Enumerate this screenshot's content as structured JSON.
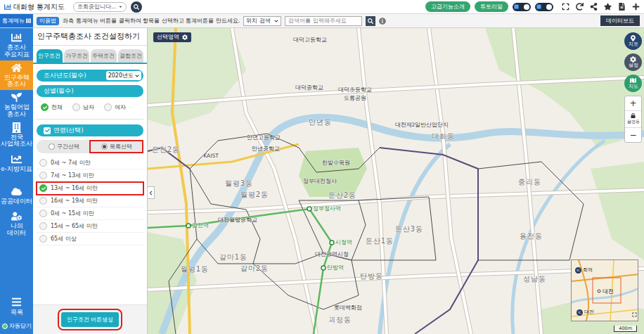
{
  "header": {
    "logo": "대화형 통계지도",
    "status_select": "조회중입니다...",
    "buttons": [
      "고급기능소개",
      "튜토리얼"
    ],
    "toggles": [
      {
        "on": true
      },
      {
        "on": true
      }
    ]
  },
  "info_bar": {
    "menu_button": "통계메뉴",
    "help_badge": "이용법",
    "hint": "좌측 통계메뉴 버튼을 클릭하여 항목을 선택하고 통계버튼을 만드세요.",
    "search_type": "위치 검색",
    "search_placeholder": "검색어를 입력해주세요",
    "databoard_button": "데이터보드"
  },
  "sidebar": {
    "items": [
      {
        "label": "총조사 주요지표",
        "selected": false
      },
      {
        "label": "인구주택 총조사",
        "selected": true
      },
      {
        "label": "농림어업 총조사",
        "selected": false
      },
      {
        "label": "전국 사업체조사",
        "selected": false
      },
      {
        "label": "e-지방지표",
        "selected": false
      },
      {
        "label": "공공데이터",
        "selected": false
      },
      {
        "label": "나의 데이터",
        "selected": false
      }
    ],
    "list_button": "목록",
    "auto_close": {
      "label": "자동닫기",
      "on": true
    }
  },
  "panel": {
    "title": "인구주택총조사 조건설정하기",
    "tabs": [
      {
        "label": "인구조건",
        "selected": true
      },
      {
        "label": "가구조건",
        "selected": false
      },
      {
        "label": "주택조건",
        "selected": false
      },
      {
        "label": "결합조건",
        "selected": false
      }
    ],
    "year": {
      "label": "조사년도(필수)",
      "value": "2020년도"
    },
    "sex": {
      "label": "성별(필수)",
      "options": [
        {
          "label": "전체",
          "selected": true
        },
        {
          "label": "남자",
          "selected": false
        },
        {
          "label": "여자",
          "selected": false
        }
      ]
    },
    "age": {
      "label": "연령(선택)",
      "checked": true,
      "modes": [
        {
          "label": "구간선택",
          "selected": false,
          "highlighted": false
        },
        {
          "label": "목록선택",
          "selected": true,
          "highlighted": true
        }
      ],
      "options": [
        {
          "label": "0세 ~ 7세 미만",
          "selected": false,
          "highlighted": false
        },
        {
          "label": "7세 ~ 13세 미만",
          "selected": false,
          "highlighted": false
        },
        {
          "label": "13세 ~ 16세 미만",
          "selected": true,
          "highlighted": true
        },
        {
          "label": "16세 ~ 19세 미만",
          "selected": false,
          "highlighted": false
        },
        {
          "label": "0세 ~ 15세 미만",
          "selected": false,
          "highlighted": false
        },
        {
          "label": "15세 ~ 65세 미만",
          "selected": false,
          "highlighted": false
        },
        {
          "label": "65세 이상",
          "selected": false,
          "highlighted": false
        }
      ]
    },
    "create_button": {
      "label": "인구조건 버튼생성",
      "highlighted": true
    }
  },
  "map": {
    "select_area_button": "선택영역",
    "labels": [
      {
        "text": "대덕고등학교",
        "kind": "poi"
      },
      {
        "text": "대덕중학교",
        "kind": "poi"
      },
      {
        "text": "대덕초등학교",
        "kind": "poi"
      },
      {
        "text": "도룡공원",
        "kind": "poi"
      },
      {
        "text": "만년동",
        "kind": "dong"
      },
      {
        "text": "만년고등학교",
        "kind": "poi"
      },
      {
        "text": "만년중학교",
        "kind": "poi"
      },
      {
        "text": "한밭수목원",
        "kind": "poi"
      },
      {
        "text": "정부대전청사",
        "kind": "poi"
      },
      {
        "text": "월평3동",
        "kind": "dong"
      },
      {
        "text": "월평2동",
        "kind": "dong"
      },
      {
        "text": "둔산2동",
        "kind": "dong"
      },
      {
        "text": "갑천역",
        "kind": "station"
      },
      {
        "text": "대전월평중학교",
        "kind": "poi"
      },
      {
        "text": "정부청사역",
        "kind": "station"
      },
      {
        "text": "시청역",
        "kind": "station"
      },
      {
        "text": "둔산1동",
        "kind": "dong"
      },
      {
        "text": "둔산3동",
        "kind": "dong"
      },
      {
        "text": "대전광역시청",
        "kind": "poi"
      },
      {
        "text": "갈마1동",
        "kind": "dong"
      },
      {
        "text": "갈마2동",
        "kind": "dong"
      },
      {
        "text": "월평1동",
        "kind": "dong"
      },
      {
        "text": "탄방역",
        "kind": "station"
      },
      {
        "text": "탄방동",
        "kind": "dong"
      },
      {
        "text": "롯데백화점",
        "kind": "poi"
      },
      {
        "text": "괴정동",
        "kind": "dong"
      },
      {
        "text": "대화동",
        "kind": "dong"
      },
      {
        "text": "대전제2일반산업단지",
        "kind": "poi"
      },
      {
        "text": "중리동",
        "kind": "dong"
      },
      {
        "text": "용전동",
        "kind": "dong"
      },
      {
        "text": "성남동",
        "kind": "dong"
      },
      {
        "text": "KAIST",
        "kind": "poi"
      },
      {
        "text": "온천2동",
        "kind": "dong"
      }
    ],
    "tools": [
      "지표",
      "설정",
      "지도"
    ],
    "zoom": {
      "plus": "+",
      "minus": "−",
      "level_label": "읍면동"
    },
    "minimap": {
      "city": "대전",
      "interchanges": [
        {
          "badge": "IC",
          "name": "회덕"
        },
        {
          "badge": "IC",
          "name": "대전"
        }
      ]
    },
    "scale": "400m"
  }
}
